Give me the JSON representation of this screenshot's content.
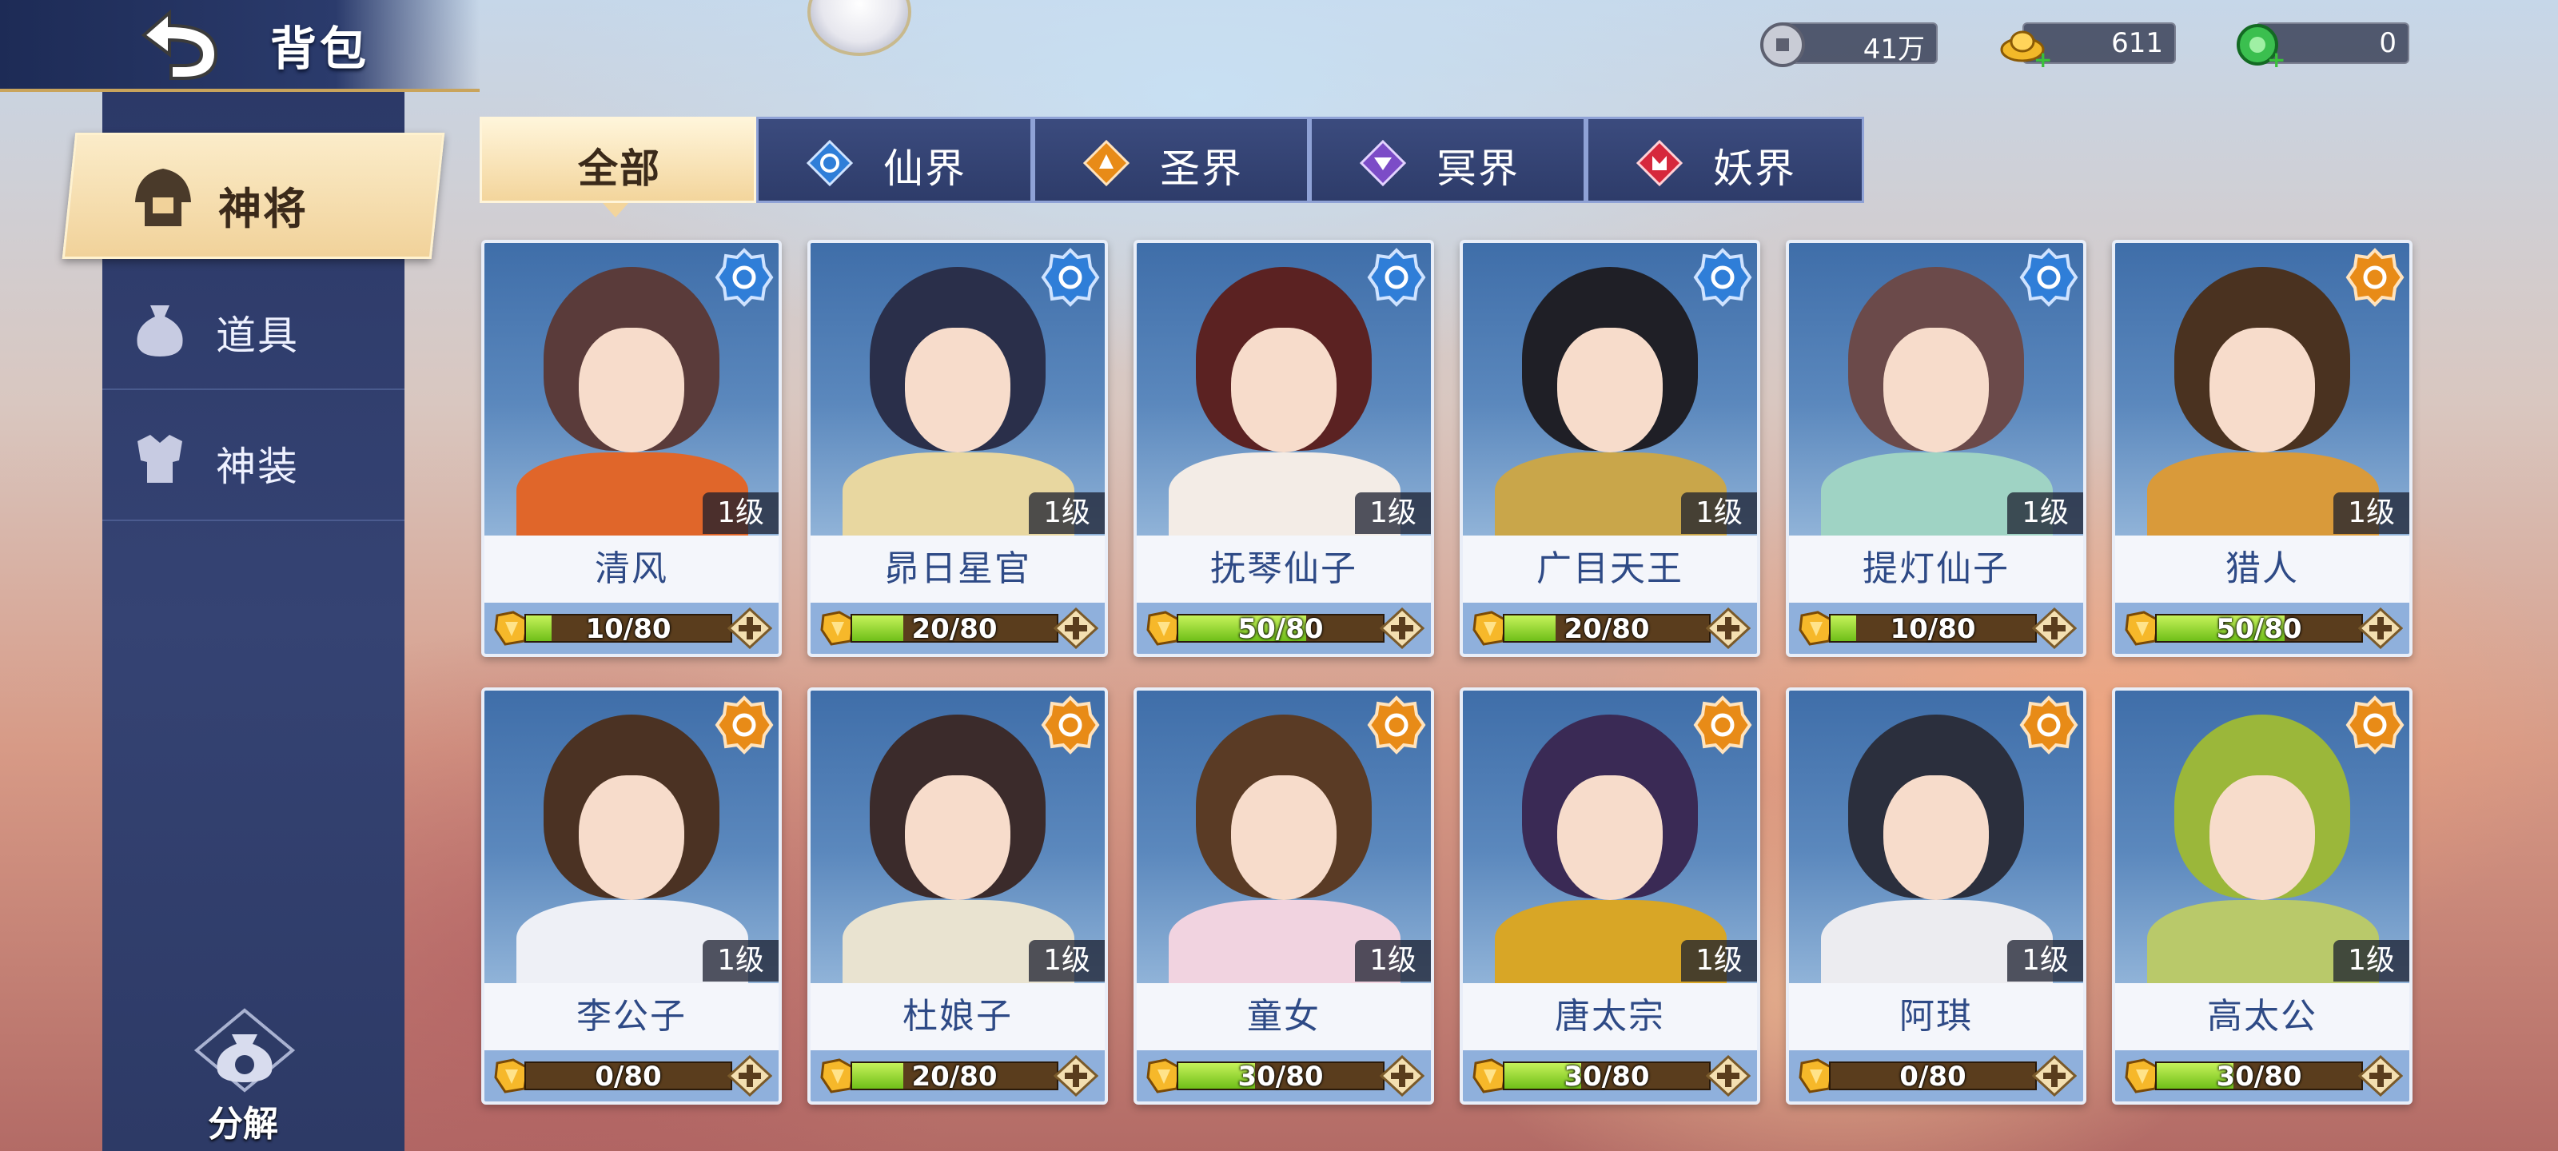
{
  "header": {
    "title": "背包"
  },
  "currencies": [
    {
      "icon": "silver-coin-icon",
      "value": "41万"
    },
    {
      "icon": "gold-ingot-icon",
      "value": "611"
    },
    {
      "icon": "jade-dragon-icon",
      "value": "0"
    }
  ],
  "sidebar": {
    "items": [
      {
        "label": "神将",
        "icon": "general-helmet-icon",
        "active": true
      },
      {
        "label": "道具",
        "icon": "item-bag-icon",
        "active": false
      },
      {
        "label": "神装",
        "icon": "armor-icon",
        "active": false
      }
    ],
    "decompose_label": "分解"
  },
  "tabs": [
    {
      "label": "全部",
      "active": true,
      "color": ""
    },
    {
      "label": "仙界",
      "active": false,
      "color": "#2f7ed8"
    },
    {
      "label": "圣界",
      "active": false,
      "color": "#e88b17"
    },
    {
      "label": "冥界",
      "active": false,
      "color": "#7c4cc7"
    },
    {
      "label": "妖界",
      "active": false,
      "color": "#d6283c"
    }
  ],
  "cards": [
    {
      "name": "清风",
      "level": "1级",
      "progress": "10/80",
      "fraction": 0.125,
      "faction": "xian",
      "hair": "#5a3b3a",
      "body": "#e0662a"
    },
    {
      "name": "昴日星官",
      "level": "1级",
      "progress": "20/80",
      "fraction": 0.25,
      "faction": "xian",
      "hair": "#2a2f4a",
      "body": "#e8d7a0"
    },
    {
      "name": "抚琴仙子",
      "level": "1级",
      "progress": "50/80",
      "fraction": 0.625,
      "faction": "xian",
      "hair": "#5b2222",
      "body": "#f3ece6"
    },
    {
      "name": "广目天王",
      "level": "1级",
      "progress": "20/80",
      "fraction": 0.25,
      "faction": "xian",
      "hair": "#1f1f26",
      "body": "#c9a64a"
    },
    {
      "name": "提灯仙子",
      "level": "1级",
      "progress": "10/80",
      "fraction": 0.125,
      "faction": "xian",
      "hair": "#6b4a4a",
      "body": "#9fd3c4"
    },
    {
      "name": "猎人",
      "level": "1级",
      "progress": "50/80",
      "fraction": 0.625,
      "faction": "sheng",
      "hair": "#4a3220",
      "body": "#d99a3a"
    },
    {
      "name": "李公子",
      "level": "1级",
      "progress": "0/80",
      "fraction": 0,
      "faction": "sheng",
      "hair": "#4b3223",
      "body": "#eef0f6"
    },
    {
      "name": "杜娘子",
      "level": "1级",
      "progress": "20/80",
      "fraction": 0.25,
      "faction": "sheng",
      "hair": "#3b2b2b",
      "body": "#e9e3d0"
    },
    {
      "name": "童女",
      "level": "1级",
      "progress": "30/80",
      "fraction": 0.375,
      "faction": "sheng",
      "hair": "#5a3b25",
      "body": "#f1d3e0"
    },
    {
      "name": "唐太宗",
      "level": "1级",
      "progress": "30/80",
      "fraction": 0.375,
      "faction": "sheng",
      "hair": "#3a2a55",
      "body": "#d8a626"
    },
    {
      "name": "阿琪",
      "level": "1级",
      "progress": "0/80",
      "fraction": 0,
      "faction": "sheng",
      "hair": "#2b2f3d",
      "body": "#ececf0"
    },
    {
      "name": "高太公",
      "level": "1级",
      "progress": "30/80",
      "fraction": 0.375,
      "faction": "sheng",
      "hair": "#9bb73a",
      "body": "#b9c96a"
    }
  ]
}
